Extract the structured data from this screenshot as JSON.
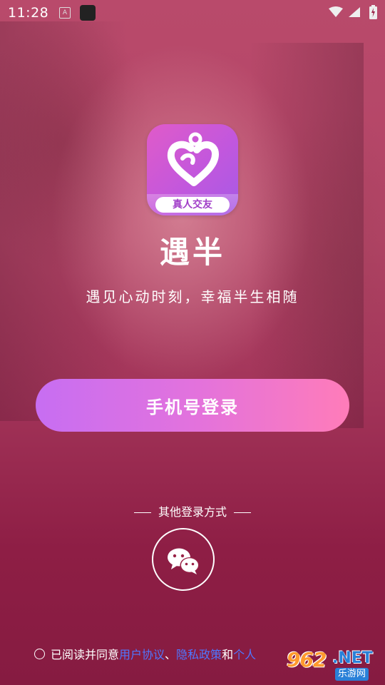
{
  "status_bar": {
    "time": "11:28",
    "icon_a_label": "A",
    "icons": [
      "notification-a-icon",
      "app-notification-icon",
      "wifi-icon",
      "signal-icon",
      "battery-charging-icon"
    ]
  },
  "app": {
    "icon_tag": "真人交友",
    "name": "遇半",
    "slogan": "遇见心动时刻，幸福半生相随"
  },
  "login": {
    "phone_button": "手机号登录",
    "other_methods_label": "其他登录方式",
    "other_methods": [
      "wechat-icon"
    ]
  },
  "agreement": {
    "prefix": "已阅读并同意",
    "user_agreement": "用户协议",
    "separator": "、",
    "privacy_policy": "隐私政策",
    "conjunction": "和",
    "personal_info": "个人"
  },
  "watermark": {
    "number": "962",
    "suffix": ".NET",
    "subtitle": "乐游网"
  },
  "colors": {
    "accent_gradient_start": "#c76ef2",
    "accent_gradient_end": "#ff7cb9",
    "link": "#4f77ff",
    "background": "#9a2347"
  }
}
